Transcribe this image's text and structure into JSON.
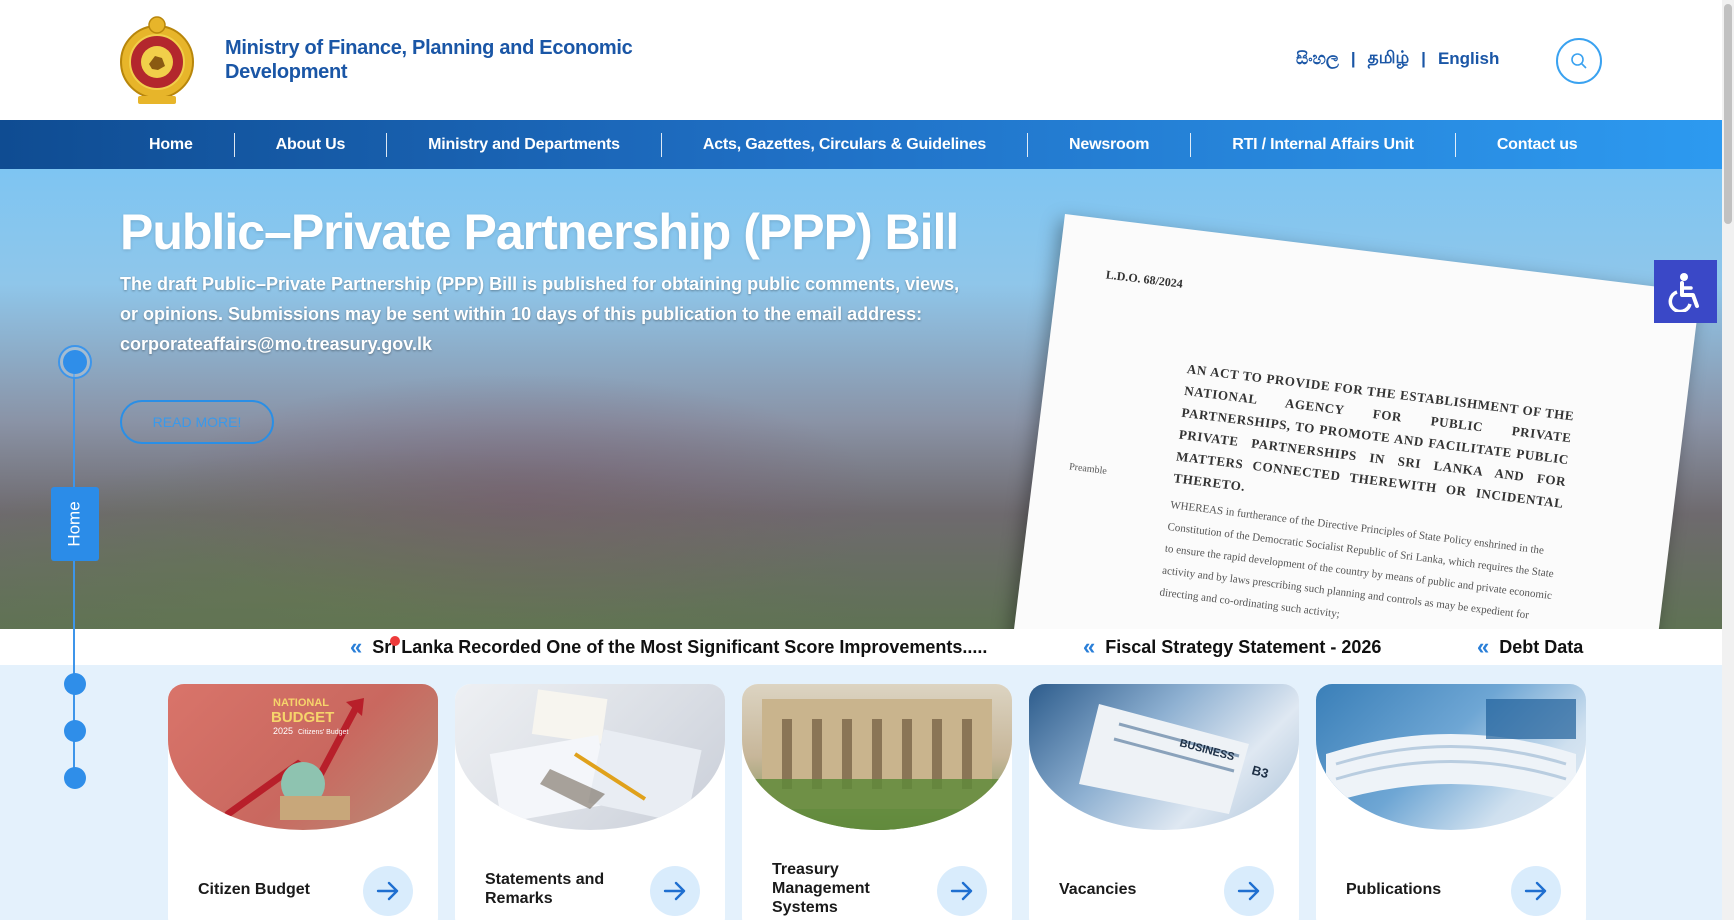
{
  "header": {
    "ministry_name": "Ministry of Finance, Planning and Economic Development",
    "languages": [
      "සිංහල",
      "தமிழ்",
      "English"
    ],
    "separator": "|"
  },
  "nav": {
    "items": [
      "Home",
      "About Us",
      "Ministry and Departments",
      "Acts, Gazettes, Circulars & Guidelines",
      "Newsroom",
      "RTI / Internal Affairs Unit",
      "Contact us"
    ]
  },
  "hero": {
    "title": "Public–Private Partnership (PPP) Bill",
    "description": "The draft Public–Private Partnership (PPP) Bill is published for obtaining public comments, views, or opinions. Submissions may be sent within 10 days of this publication to the email address: corporateaffairs@mo.treasury.gov.lk",
    "read_more": "READ MORE!",
    "document": {
      "ref": "L.D.O. 68/2024",
      "act_text": "AN ACT TO PROVIDE FOR THE ESTABLISHMENT OF THE NATIONAL AGENCY FOR PUBLIC PRIVATE PARTNERSHIPS, TO PROMOTE AND FACILITATE PUBLIC PRIVATE PARTNERSHIPS IN SRI LANKA AND FOR MATTERS CONNECTED THEREWITH OR INCIDENTAL THERETO.",
      "preamble_label": "Preamble",
      "body": "WHEREAS in furtherance of the Directive Principles of State Policy enshrined in the Constitution of the Democratic Socialist Republic of Sri Lanka, which requires the State to ensure the rapid development of the country by means of public and private economic activity and by laws prescribing such planning and controls as may be expedient for directing and co-ordinating such activity;"
    }
  },
  "side_tab": {
    "label": "Home"
  },
  "ticker": {
    "items": [
      "Sri Lanka Recorded One of the Most Significant Score Improvements.....",
      "Fiscal Strategy Statement - 2026",
      "Debt Data"
    ],
    "chevron": "«"
  },
  "cards": [
    {
      "label": "Citizen Budget",
      "image_text": [
        "NATIONAL",
        "BUDGET",
        "2025",
        "Citizens' Budget"
      ]
    },
    {
      "label": "Statements and Remarks"
    },
    {
      "label": "Treasury Management Systems"
    },
    {
      "label": "Vacancies",
      "image_text": [
        "BUSINESS",
        "B3"
      ]
    },
    {
      "label": "Publications"
    }
  ],
  "colors": {
    "brand_blue": "#1a56a6",
    "nav_dark": "#0f4c92",
    "nav_light": "#2d9af0",
    "accent": "#2f8ee9",
    "accessibility": "#3a48c7",
    "ticker_alert": "#ee3b3b"
  },
  "icons": {
    "emblem": "sri-lanka-emblem",
    "search": "search-icon",
    "accessibility": "wheelchair-icon",
    "arrow": "arrow-right-icon",
    "ticker": "double-chevron-left-icon"
  }
}
